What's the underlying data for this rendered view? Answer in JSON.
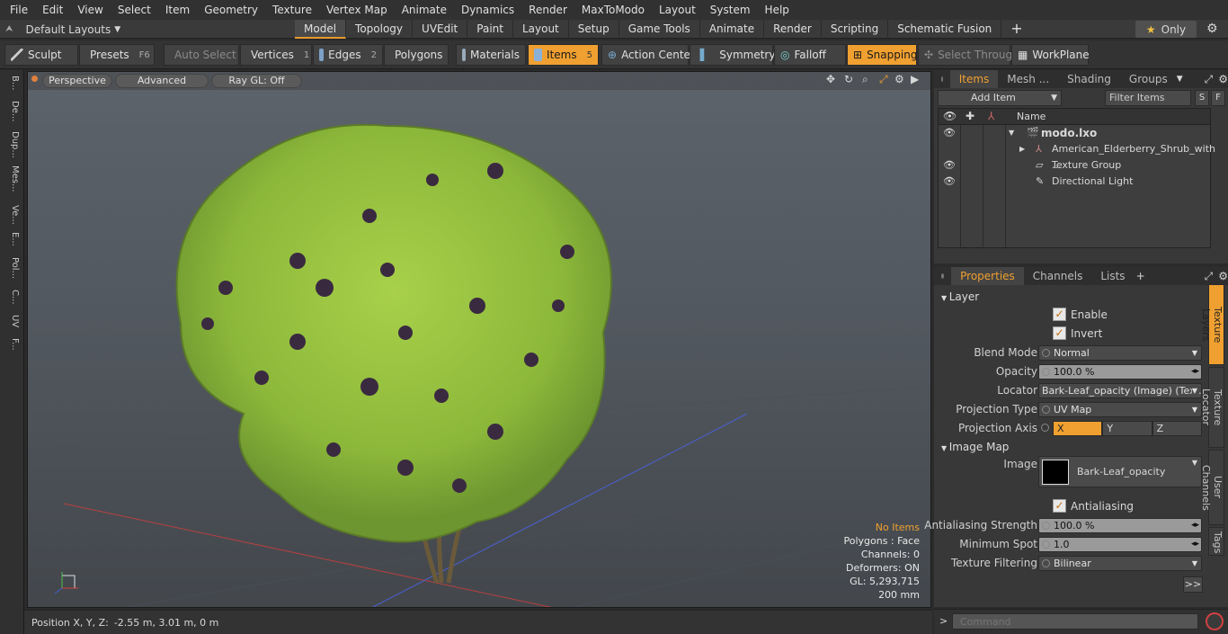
{
  "menu": [
    "File",
    "Edit",
    "View",
    "Select",
    "Item",
    "Geometry",
    "Texture",
    "Vertex Map",
    "Animate",
    "Dynamics",
    "Render",
    "MaxToModo",
    "Layout",
    "System",
    "Help"
  ],
  "layout": {
    "label": "Default Layouts"
  },
  "tabs": [
    "Model",
    "Topology",
    "UVEdit",
    "Paint",
    "Layout",
    "Setup",
    "Game Tools",
    "Animate",
    "Render",
    "Scripting",
    "Schematic Fusion"
  ],
  "only_label": "Only",
  "toolbar": {
    "sculpt": "Sculpt",
    "presets": "Presets",
    "presets_key": "F6",
    "auto_select": "Auto Select",
    "vertices": "Vertices",
    "vertices_num": "1",
    "edges": "Edges",
    "edges_num": "2",
    "polygons": "Polygons",
    "materials": "Materials",
    "items": "Items",
    "items_num": "5",
    "action_center": "Action Center",
    "symmetry": "Symmetry",
    "falloff": "Falloff",
    "snapping": "Snapping",
    "select_through": "Select Through",
    "workplane": "WorkPlane"
  },
  "left_tabs": [
    "B...",
    "De...",
    "Dup...",
    "Mes...",
    "Ve...",
    "E...",
    "Pol...",
    "C...",
    "UV",
    "F..."
  ],
  "viewport": {
    "perspective": "Perspective",
    "advanced": "Advanced",
    "raygl": "Ray GL: Off"
  },
  "hud": {
    "no_items": "No Items",
    "polygons": "Polygons : Face",
    "channels": "Channels: 0",
    "deformers": "Deformers: ON",
    "gl": "GL: 5,293,715",
    "scale": "200 mm"
  },
  "status": {
    "label": "Position X, Y, Z:",
    "value": "-2.55 m, 3.01 m, 0 m"
  },
  "items_panel": {
    "tabs": [
      "Items",
      "Mesh ...",
      "Shading",
      "Groups"
    ],
    "add_item": "Add Item",
    "filter": "Filter Items",
    "s": "S",
    "f": "F",
    "col_name": "Name",
    "rows": [
      "modo.lxo",
      "American_Elderberry_Shrub_with ...",
      "Texture Group",
      "Directional Light"
    ]
  },
  "props_panel": {
    "tabs": [
      "Properties",
      "Channels",
      "Lists"
    ],
    "layer": "Layer",
    "enable": "Enable",
    "invert": "Invert",
    "blend_mode_label": "Blend Mode",
    "blend_mode": "Normal",
    "opacity_label": "Opacity",
    "opacity": "100.0 %",
    "locator_label": "Locator",
    "locator": "Bark-Leaf_opacity (Image) (Tex...",
    "proj_type_label": "Projection Type",
    "proj_type": "UV Map",
    "proj_axis_label": "Projection Axis",
    "axis_x": "X",
    "axis_y": "Y",
    "axis_z": "Z",
    "image_map": "Image Map",
    "image_label": "Image",
    "image": "Bark-Leaf_opacity",
    "antialiasing": "Antialiasing",
    "aa_strength_label": "Antialiasing Strength",
    "aa_strength": "100.0 %",
    "min_spot_label": "Minimum Spot",
    "min_spot": "1.0",
    "tex_filter_label": "Texture Filtering",
    "tex_filter": "Bilinear",
    "more": ">>"
  },
  "side_tabs": [
    "Texture Layers",
    "Texture Locator",
    "User Channels",
    "Tags"
  ],
  "command_placeholder": "Command"
}
